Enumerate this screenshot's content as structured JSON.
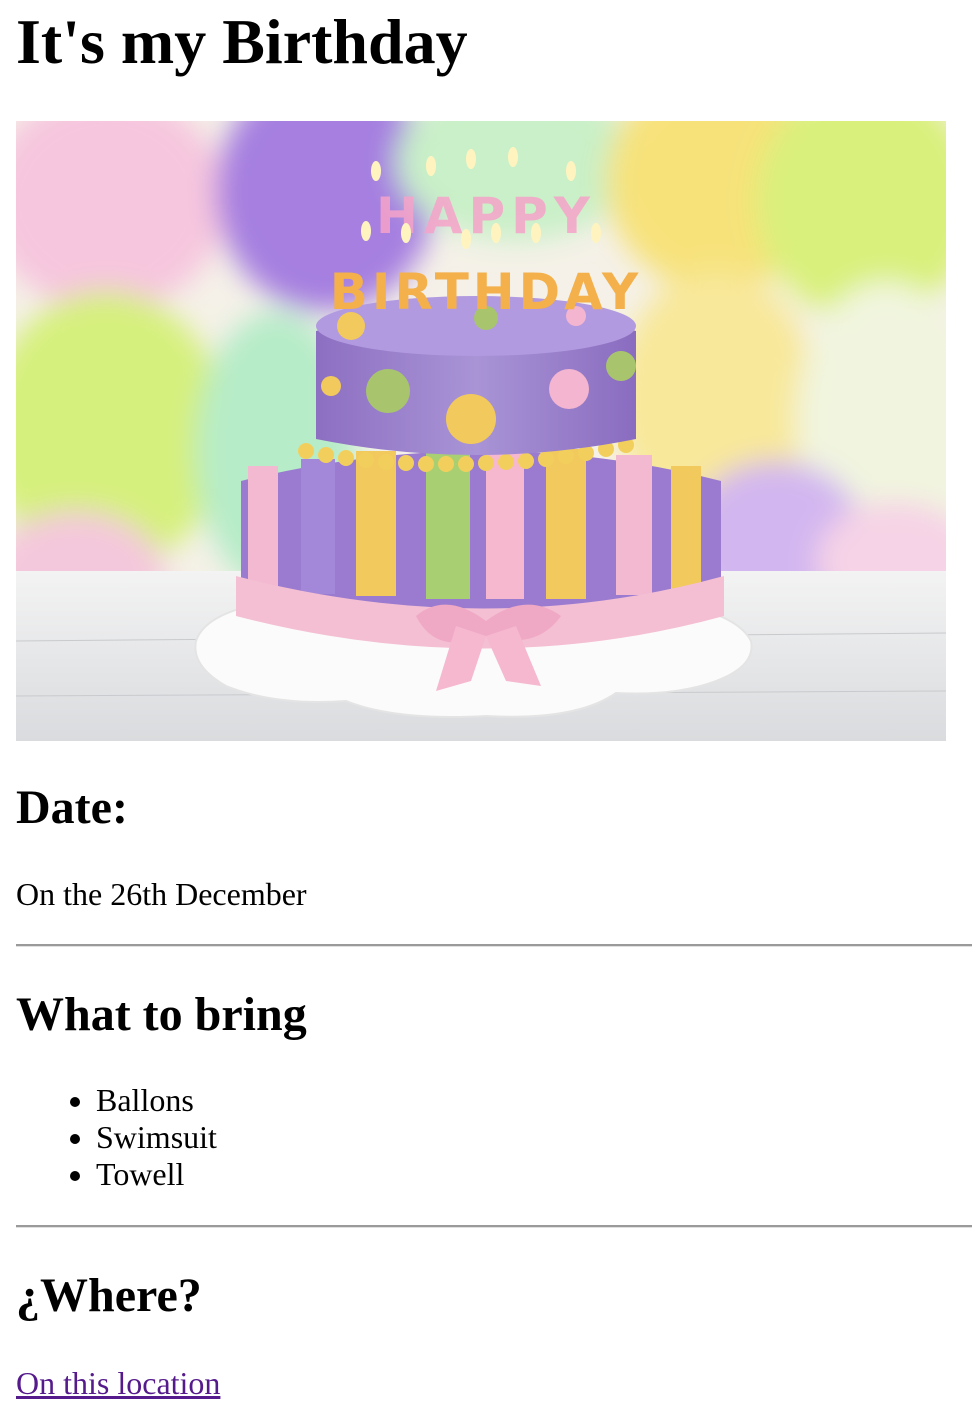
{
  "header": {
    "title": "It's my Birthday"
  },
  "image": {
    "candle_letters_top": "HAPPY",
    "candle_letters_bottom": "BIRTHDAY"
  },
  "date_section": {
    "heading": "Date:",
    "text": "On the 26th December"
  },
  "bring_section": {
    "heading": "What to bring",
    "items": [
      "Ballons",
      "Swimsuit",
      "Towell"
    ]
  },
  "where_section": {
    "heading": "¿Where?",
    "link_text": "On this location"
  },
  "colors": {
    "link_visited": "#551a8b",
    "rule": "#9a9a9a"
  }
}
